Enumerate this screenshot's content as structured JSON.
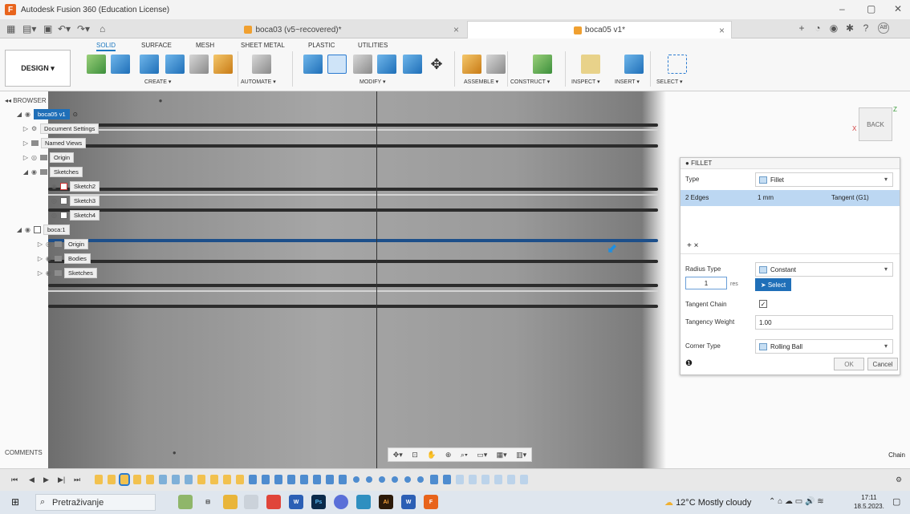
{
  "titlebar": {
    "title": "Autodesk Fusion 360 (Education License)",
    "minimize": "–",
    "maximize": "▢",
    "close": "✕"
  },
  "tabs": [
    {
      "label": "boca03 (v5~recovered)*"
    },
    {
      "label": "boca05 v1*"
    }
  ],
  "profile": {
    "initials": "AB"
  },
  "ribbon": {
    "tabs": [
      "SOLID",
      "SURFACE",
      "MESH",
      "SHEET METAL",
      "PLASTIC",
      "UTILITIES"
    ],
    "workspace_label": "DESIGN ▾",
    "groups": [
      "CREATE ▾",
      "AUTOMATE ▾",
      "MODIFY ▾",
      "ASSEMBLE ▾",
      "CONSTRUCT ▾",
      "INSPECT ▾",
      "INSERT ▾",
      "SELECT ▾"
    ]
  },
  "browser": {
    "header": "BROWSER",
    "root": "boca05 v1",
    "nodes": [
      "Document Settings",
      "Named Views",
      "Origin",
      "Sketches",
      "Sketch2",
      "Sketch3",
      "Sketch4",
      "boca:1",
      "Origin",
      "Bodies",
      "Sketches"
    ]
  },
  "viewcube": {
    "face": "BACK",
    "x_axis": "X",
    "z_axis": "Z"
  },
  "fillet": {
    "title": "FILLET",
    "type_label": "Type",
    "type_value": "Fillet",
    "edges_label": "2 Edges",
    "edges_radius": "1 mm",
    "edges_continuity": "Tangent (G1)",
    "add_remove": "+  ×",
    "radius_type_label": "Radius Type",
    "radius_type_value": "Constant",
    "radius_input": "1",
    "radius_unit_hint": "res",
    "select_button": "Select",
    "tangent_chain_label": "Tangent Chain",
    "tangent_chain_checked": true,
    "tangency_weight_label": "Tangency Weight",
    "tangency_weight_value": "1.00",
    "corner_type_label": "Corner Type",
    "corner_type_value": "Rolling Ball",
    "ok": "OK",
    "cancel": "Cancel"
  },
  "comments": {
    "label": "COMMENTS"
  },
  "status": {
    "chain": "Chain"
  },
  "taskbar": {
    "search_placeholder": "Pretraživanje",
    "weather": "12°C  Mostly cloudy",
    "time": "17:11",
    "date": "18.5.2023."
  },
  "colors": {
    "accent": "#1f6fb8",
    "selection_row": "#bcd7f2",
    "body_grey": "#8f8f8f"
  }
}
